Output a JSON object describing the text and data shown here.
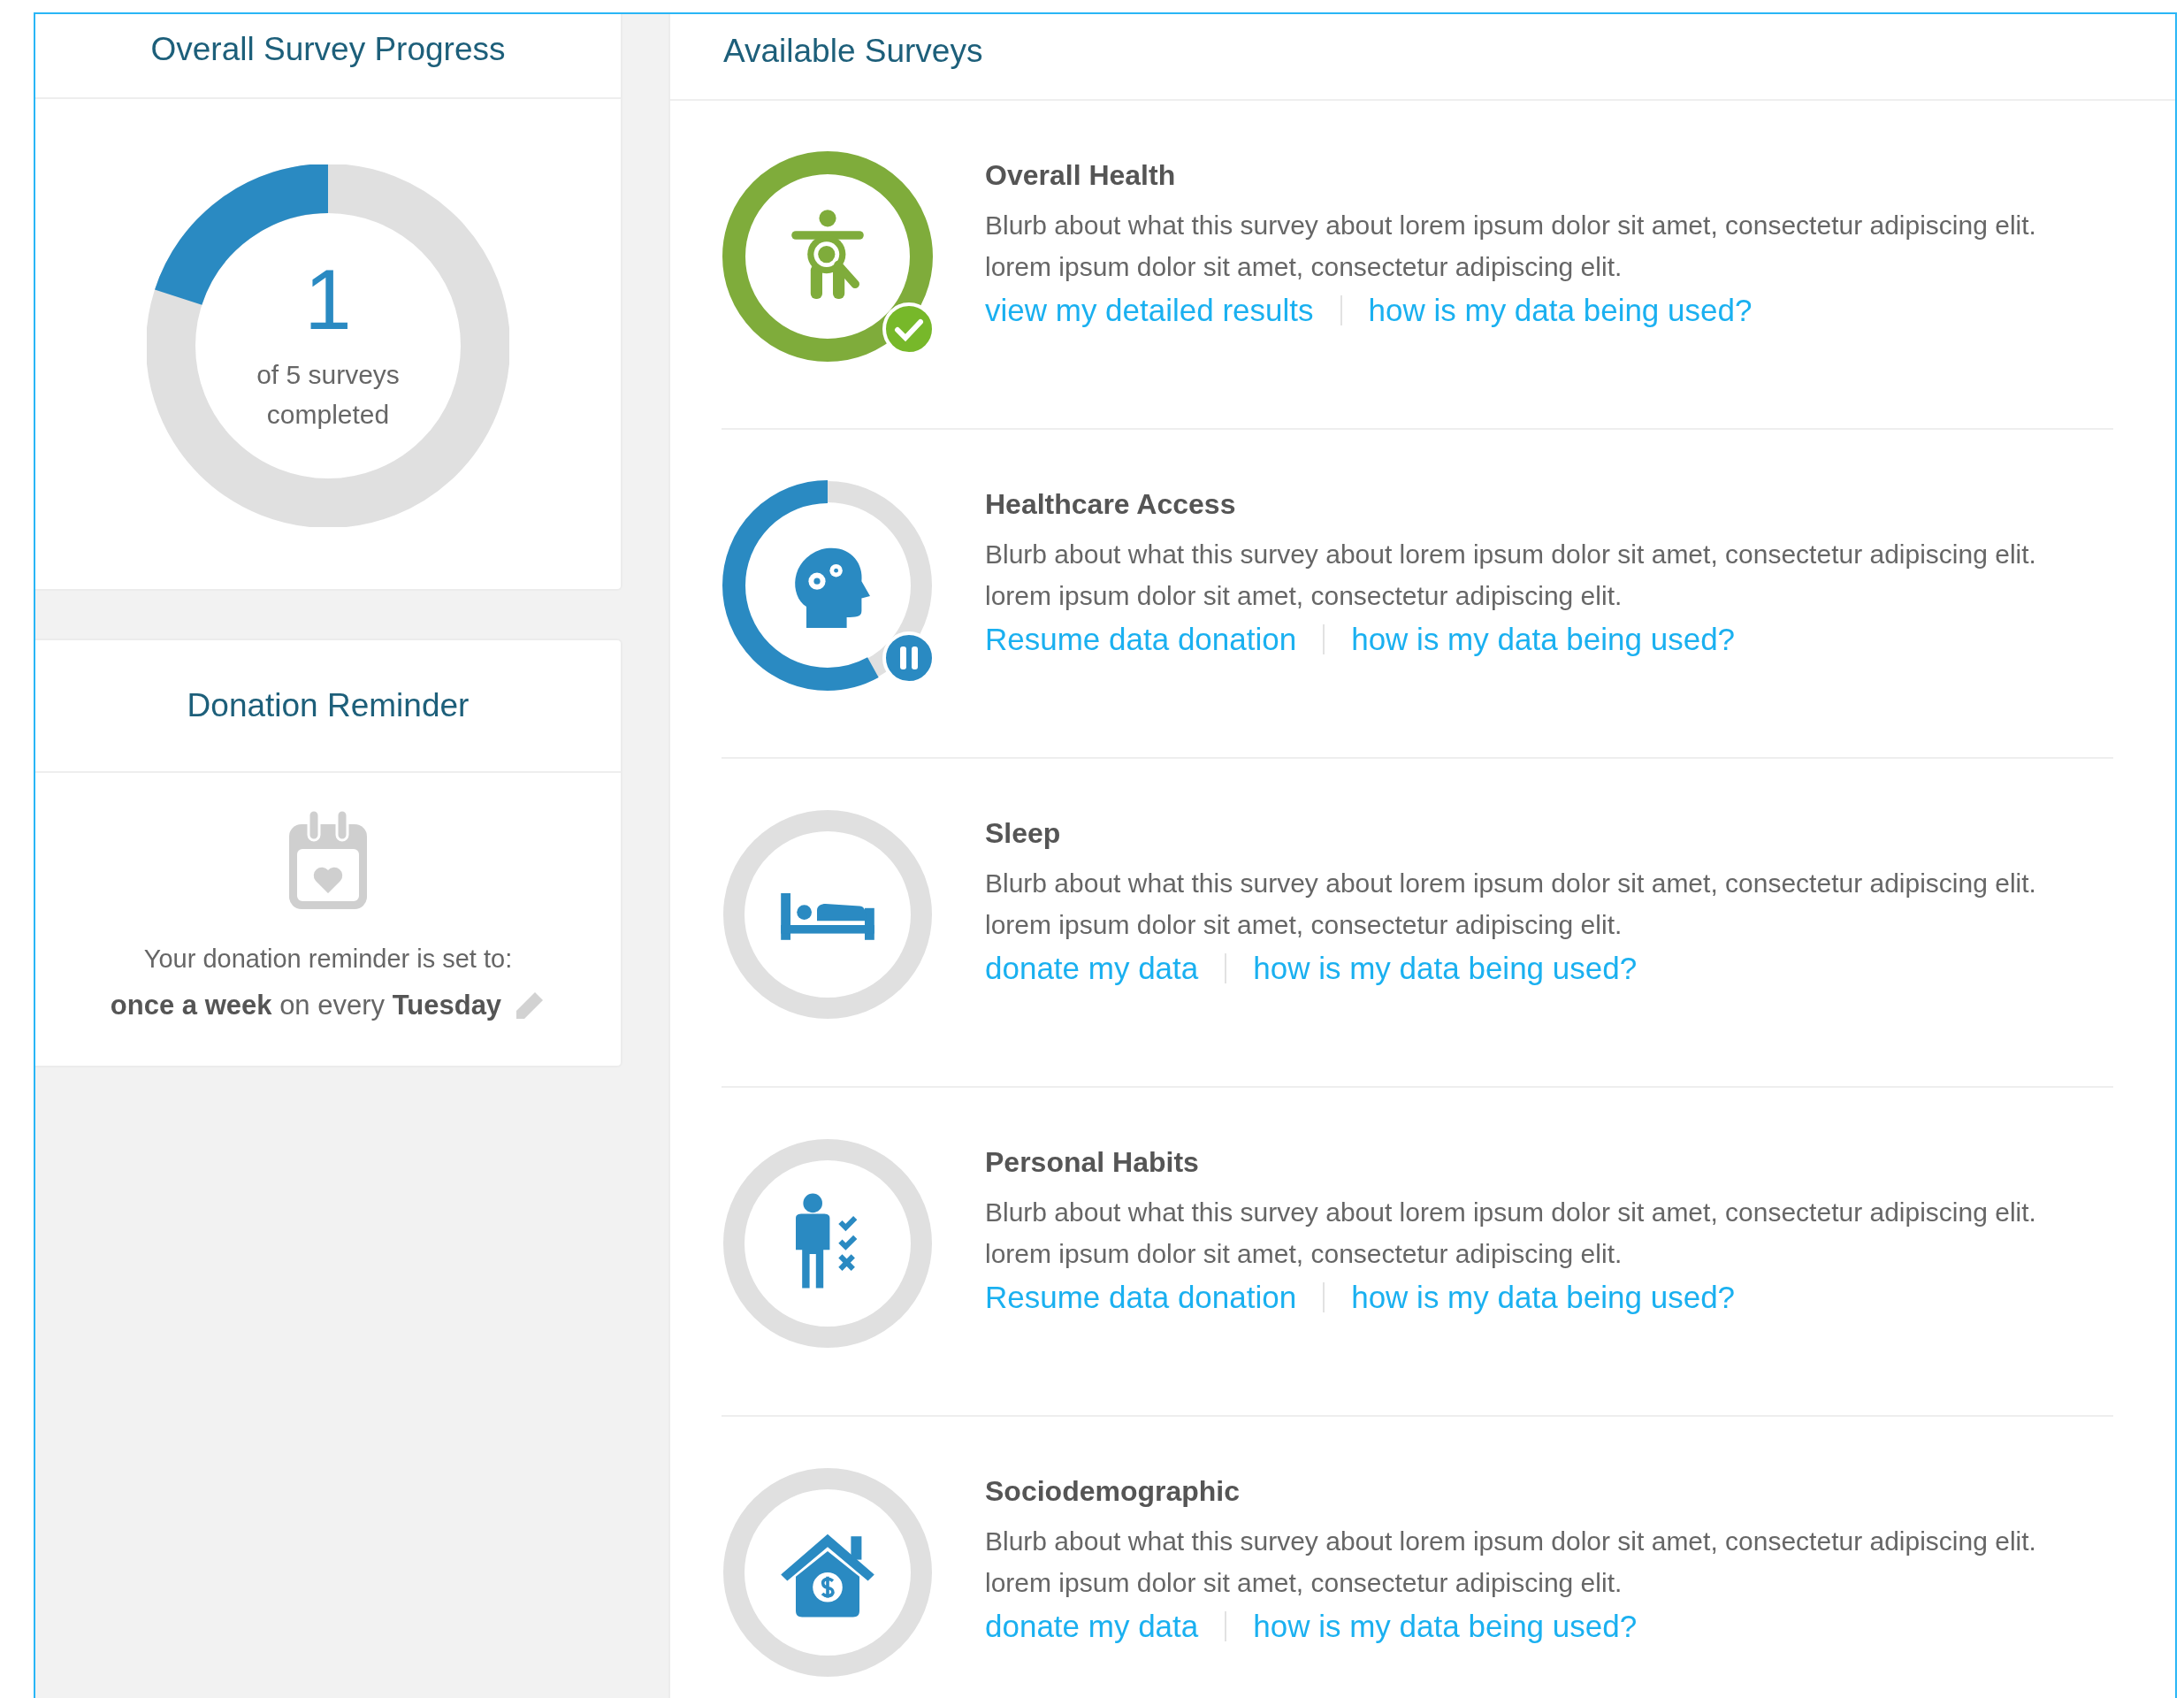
{
  "progress_panel": {
    "title": "Overall Survey Progress",
    "count": "1",
    "caption": "of 5 surveys completed"
  },
  "reminder_panel": {
    "title": "Donation Reminder",
    "intro": "Your donation reminder is set to:",
    "schedule": "**once a week** on every **Tuesday**"
  },
  "surveys_panel": {
    "title": "Available Surveys"
  },
  "surveys": [
    {
      "title": "Overall Health",
      "completed": true,
      "paused": false,
      "blurb": "Blurb about what this survey about lorem ipsum dolor sit amet, consectetur adipiscing elit. lorem ipsum dolor sit amet, consectetur adipiscing elit.",
      "links": [
        "view my detailed results",
        "how is my data being used?"
      ]
    },
    {
      "title": "Healthcare Access",
      "completed": false,
      "paused": true,
      "blurb": "Blurb about what this survey about lorem ipsum dolor sit amet, consectetur adipiscing elit. lorem ipsum dolor sit amet, consectetur adipiscing elit.",
      "links": [
        "Resume data donation",
        "how is my data being used?"
      ]
    },
    {
      "title": "Sleep",
      "completed": false,
      "paused": false,
      "blurb": "Blurb about what this survey about lorem ipsum dolor sit amet, consectetur adipiscing elit. lorem ipsum dolor sit amet, consectetur adipiscing elit.",
      "links": [
        "donate my data",
        "how is my data being used?"
      ]
    },
    {
      "title": "Personal Habits",
      "completed": false,
      "paused": false,
      "blurb": "Blurb about what this survey about lorem ipsum dolor sit amet, consectetur adipiscing elit. lorem ipsum dolor sit amet, consectetur adipiscing elit.",
      "links": [
        "Resume data donation",
        "how is my data being used?"
      ]
    },
    {
      "title": "Sociodemographic",
      "completed": false,
      "paused": false,
      "blurb": "Blurb about what this survey about lorem ipsum dolor sit amet, consectetur adipiscing elit. lorem ipsum dolor sit amet, consectetur adipiscing elit.",
      "links": [
        "donate my data",
        "how is my data being used?"
      ]
    }
  ]
}
